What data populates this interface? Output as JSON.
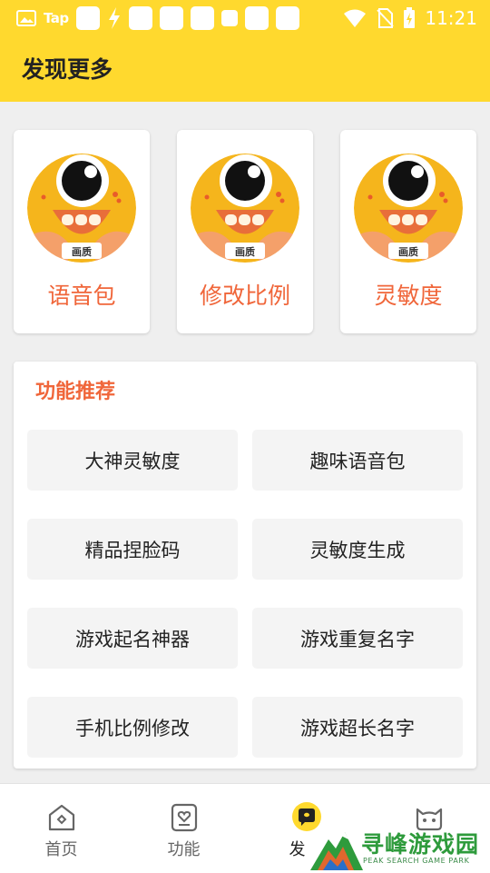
{
  "status_bar": {
    "time": "11:21",
    "tap_label": "Tap",
    "icons": [
      "image-icon",
      "tap-icon",
      "app-square-icon",
      "bolt-icon",
      "wifi-icon",
      "no-sim-icon",
      "battery-charging-icon"
    ]
  },
  "header": {
    "title": "发现更多"
  },
  "quick_cards": [
    {
      "label": "语音包",
      "icon": "mascot-icon",
      "badge": "画质"
    },
    {
      "label": "修改比例",
      "icon": "mascot-icon",
      "badge": "画质"
    },
    {
      "label": "灵敏度",
      "icon": "mascot-icon",
      "badge": "画质"
    }
  ],
  "features": {
    "title": "功能推荐",
    "items": [
      {
        "label": "大神灵敏度"
      },
      {
        "label": "趣味语音包"
      },
      {
        "label": "精品捏脸码"
      },
      {
        "label": "灵敏度生成"
      },
      {
        "label": "游戏起名神器"
      },
      {
        "label": "游戏重复名字"
      },
      {
        "label": "手机比例修改"
      },
      {
        "label": "游戏超长名字"
      }
    ]
  },
  "bottom_nav": {
    "items": [
      {
        "label": "首页",
        "icon": "home-icon"
      },
      {
        "label": "功能",
        "icon": "heart-card-icon"
      },
      {
        "label": "发",
        "icon": "chat-bubble-icon",
        "active": true
      },
      {
        "label": "",
        "icon": "cat-face-icon"
      }
    ]
  },
  "watermark": {
    "text": "寻峰游戏园",
    "sub": "PEAK SEARCH GAME PARK"
  },
  "colors": {
    "header_bg": "#FFD92E",
    "accent_orange": "#F0663A",
    "page_bg": "#EFEFEF",
    "button_bg": "#F4F4F4"
  }
}
